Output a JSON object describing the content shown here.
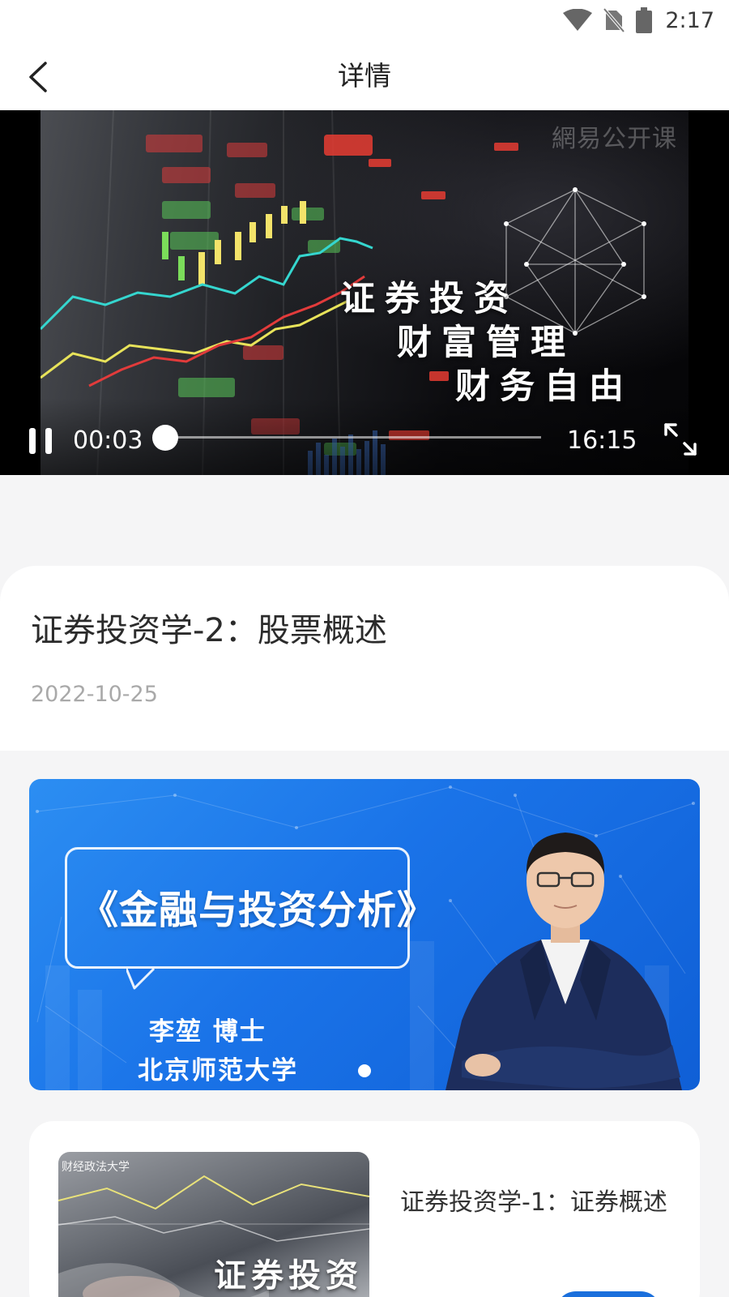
{
  "status_bar": {
    "time": "2:17"
  },
  "nav": {
    "title": "详情"
  },
  "video": {
    "watermark": "網易公开课",
    "slogan": [
      "证券投资",
      "财富管理",
      "财务自由"
    ],
    "current_time": "00:03",
    "total_time": "16:15",
    "progress_fraction": 0.003
  },
  "course": {
    "title": "证券投资学-2：股票概述",
    "date": "2022-10-25"
  },
  "banner": {
    "title": "《金融与投资分析》",
    "line1": "李堃 博士",
    "line2": "北京师范大学",
    "active_slide": 1,
    "slide_count": 1
  },
  "related": [
    {
      "title": "证券投资学-1：证券概述",
      "thumb_header": "财经政法大学",
      "thumb_text": "证券投资"
    }
  ],
  "colors": {
    "accent": "#1a6fdc",
    "banner_blue": "#1a73e8",
    "background": "#f5f5f6"
  }
}
